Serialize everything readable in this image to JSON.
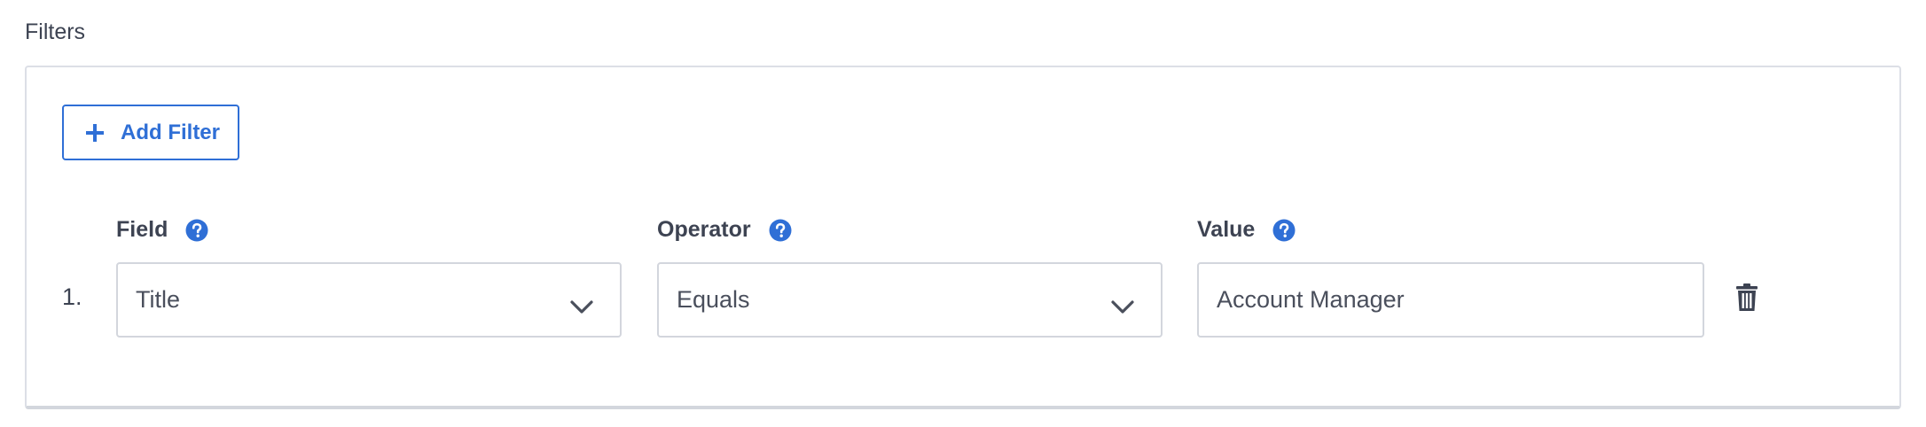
{
  "section": {
    "title": "Filters"
  },
  "toolbar": {
    "add_filter_label": "Add Filter",
    "add_icon": "plus-icon"
  },
  "columns": {
    "field_label": "Field",
    "operator_label": "Operator",
    "value_label": "Value",
    "help_icon": "help-circle-icon"
  },
  "rows": [
    {
      "number": "1.",
      "field_value": "Title",
      "operator_value": "Equals",
      "value_value": "Account Manager",
      "delete_icon": "trash-icon"
    }
  ],
  "colors": {
    "accent": "#2f6fd6",
    "text": "#3d4352",
    "border": "#d3d6dd"
  }
}
